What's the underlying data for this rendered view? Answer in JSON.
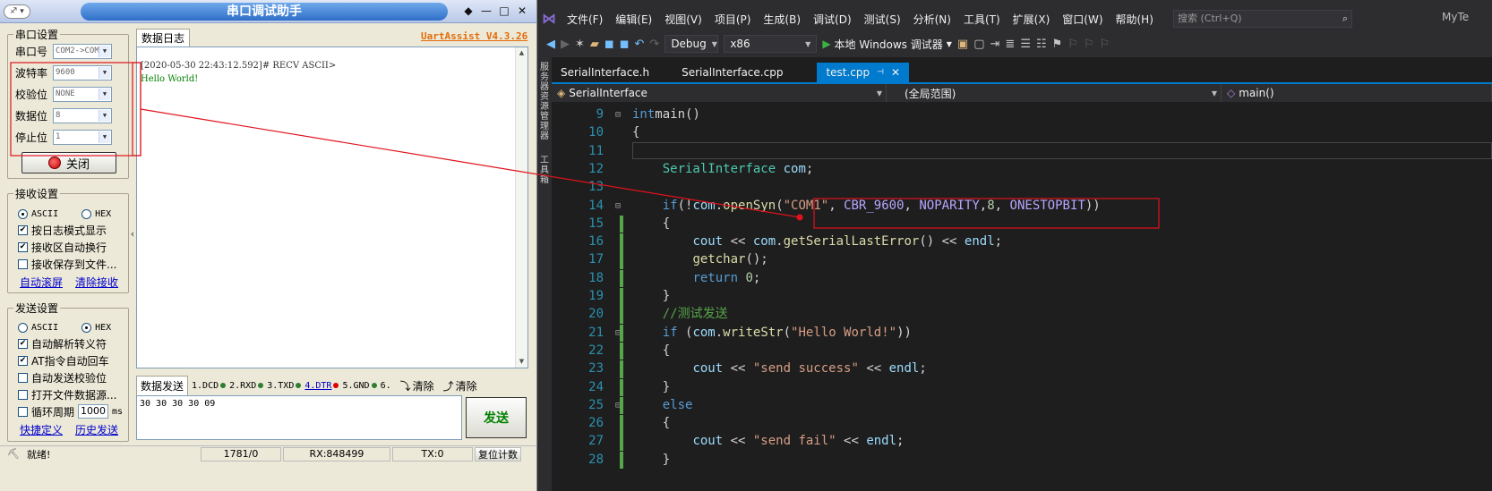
{
  "serial": {
    "title": "串口调试助手",
    "app_icon_text": "♐ ▾",
    "version": "UartAssist V4.3.26",
    "window_buttons": [
      "◆",
      "—",
      "□",
      "✕"
    ],
    "port_settings": {
      "group_title": "串口设置",
      "rows": [
        {
          "label": "串口号",
          "value": "COM2->COM"
        },
        {
          "label": "波特率",
          "value": "9600"
        },
        {
          "label": "校验位",
          "value": "NONE"
        },
        {
          "label": "数据位",
          "value": "8"
        },
        {
          "label": "停止位",
          "value": "1"
        }
      ],
      "close_button": "关闭"
    },
    "recv_settings": {
      "group_title": "接收设置",
      "ascii": "ASCII",
      "hex": "HEX",
      "checks": [
        {
          "label": "按日志模式显示",
          "checked": true
        },
        {
          "label": "接收区自动换行",
          "checked": true
        },
        {
          "label": "接收保存到文件...",
          "checked": false
        }
      ],
      "links": [
        "自动滚屏",
        "清除接收"
      ]
    },
    "send_settings": {
      "group_title": "发送设置",
      "ascii": "ASCII",
      "hex": "HEX",
      "checks": [
        {
          "label": "自动解析转义符",
          "checked": true
        },
        {
          "label": "AT指令自动回车",
          "checked": true
        },
        {
          "label": "自动发送校验位",
          "checked": false
        },
        {
          "label": "打开文件数据源...",
          "checked": false
        }
      ],
      "cycle_label": "循环周期",
      "cycle_value": "1000",
      "cycle_unit": "ms",
      "links": [
        "快捷定义",
        "历史发送"
      ]
    },
    "log_tab": "数据日志",
    "log_lines": [
      "[2020-05-30 22:43:12.592]# RECV ASCII>",
      "Hello World!"
    ],
    "send_tab": "数据发送",
    "pins": [
      {
        "label": "1.DCD",
        "color": "g"
      },
      {
        "label": "2.RXD",
        "color": "g"
      },
      {
        "label": "3.TXD",
        "color": "g"
      },
      {
        "label": "4.DTR",
        "color": "r"
      },
      {
        "label": "5.GND",
        "color": "g"
      },
      {
        "label": "6.",
        "color": "g"
      }
    ],
    "clear1": "清除",
    "clear2": "清除",
    "send_text": "30 30 30 30 09",
    "send_button": "发送",
    "status": {
      "ready": "就绪!",
      "count": "1781/0",
      "rx": "RX:848499",
      "tx": "TX:0",
      "reset": "复位计数"
    }
  },
  "vs": {
    "logo": "⋈",
    "menu": [
      "文件(F)",
      "编辑(E)",
      "视图(V)",
      "项目(P)",
      "生成(B)",
      "调试(D)",
      "测试(S)",
      "分析(N)",
      "工具(T)",
      "扩展(X)",
      "窗口(W)",
      "帮助(H)"
    ],
    "search_placeholder": "搜索 (Ctrl+Q)",
    "user": "MyTe",
    "config": "Debug",
    "platform": "x86",
    "run_label": "本地 Windows 调试器",
    "side_labels": [
      "服务器资源管理器",
      "工具箱"
    ],
    "tabs": [
      {
        "label": "SerialInterface.h",
        "active": false
      },
      {
        "label": "SerialInterface.cpp",
        "active": false
      },
      {
        "label": "test.cpp",
        "active": true
      }
    ],
    "nav": [
      "SerialInterface",
      "(全局范围)",
      "main()"
    ],
    "lines": [
      {
        "n": "9",
        "fold": "⊟",
        "bar": "",
        "code": [
          [
            "ty",
            ""
          ],
          [
            "kw",
            "int"
          ],
          [
            "",
            "main()"
          ]
        ]
      },
      {
        "n": "10",
        "fold": "",
        "bar": "",
        "code": [
          [
            "",
            "{"
          ]
        ]
      },
      {
        "n": "11",
        "fold": "",
        "bar": "",
        "code": [
          [
            "",
            ""
          ]
        ]
      },
      {
        "n": "12",
        "fold": "",
        "bar": "",
        "code": [
          [
            "",
            "    "
          ],
          [
            "ty",
            "SerialInterface"
          ],
          [
            "",
            ""
          ],
          [
            "var",
            " com"
          ],
          [
            "",
            ";"
          ]
        ]
      },
      {
        "n": "13",
        "fold": "",
        "bar": "",
        "code": [
          [
            "",
            ""
          ]
        ]
      },
      {
        "n": "14",
        "fold": "⊟",
        "bar": "",
        "code": [
          [
            "",
            "    "
          ],
          [
            "kw",
            "if"
          ],
          [
            "",
            "(!"
          ],
          [
            "var",
            "com"
          ],
          [
            "",
            "."
          ],
          [
            "fn",
            "openSyn"
          ],
          [
            "",
            "("
          ],
          [
            "st",
            "\"COM1\""
          ],
          [
            "",
            ", "
          ],
          [
            "mac",
            "CBR_9600"
          ],
          [
            "",
            ", "
          ],
          [
            "mac",
            "NOPARITY"
          ],
          [
            "",
            ","
          ],
          [
            "num",
            "8"
          ],
          [
            "",
            ", "
          ],
          [
            "mac",
            "ONESTOPBIT"
          ],
          [
            "",
            "))"
          ]
        ]
      },
      {
        "n": "15",
        "fold": "",
        "bar": "g",
        "code": [
          [
            "",
            "    {"
          ]
        ]
      },
      {
        "n": "16",
        "fold": "",
        "bar": "g",
        "code": [
          [
            "",
            "        "
          ],
          [
            "var",
            "cout"
          ],
          [
            "",
            " << "
          ],
          [
            "var",
            "com"
          ],
          [
            "",
            "."
          ],
          [
            "fn",
            "getSerialLastError"
          ],
          [
            "",
            "() << "
          ],
          [
            "var",
            "endl"
          ],
          [
            "",
            ";"
          ]
        ]
      },
      {
        "n": "17",
        "fold": "",
        "bar": "g",
        "code": [
          [
            "",
            "        "
          ],
          [
            "fn",
            "getchar"
          ],
          [
            "",
            "();"
          ]
        ]
      },
      {
        "n": "18",
        "fold": "",
        "bar": "g",
        "code": [
          [
            "",
            "        "
          ],
          [
            "kw",
            "return"
          ],
          [
            "",
            " "
          ],
          [
            "num",
            "0"
          ],
          [
            "",
            ";"
          ]
        ]
      },
      {
        "n": "19",
        "fold": "",
        "bar": "g",
        "code": [
          [
            "",
            "    }"
          ]
        ]
      },
      {
        "n": "20",
        "fold": "",
        "bar": "g",
        "code": [
          [
            "",
            "    "
          ],
          [
            "cm",
            "//测试发送"
          ]
        ]
      },
      {
        "n": "21",
        "fold": "⊟",
        "bar": "g",
        "code": [
          [
            "",
            "    "
          ],
          [
            "kw",
            "if"
          ],
          [
            "",
            " ("
          ],
          [
            "var",
            "com"
          ],
          [
            "",
            "."
          ],
          [
            "fn",
            "writeStr"
          ],
          [
            "",
            "("
          ],
          [
            "st",
            "\"Hello World!\""
          ],
          [
            "",
            "))"
          ]
        ]
      },
      {
        "n": "22",
        "fold": "",
        "bar": "g",
        "code": [
          [
            "",
            "    {"
          ]
        ]
      },
      {
        "n": "23",
        "fold": "",
        "bar": "g",
        "code": [
          [
            "",
            "        "
          ],
          [
            "var",
            "cout"
          ],
          [
            "",
            " << "
          ],
          [
            "st",
            "\"send success\""
          ],
          [
            "",
            " << "
          ],
          [
            "var",
            "endl"
          ],
          [
            "",
            ";"
          ]
        ]
      },
      {
        "n": "24",
        "fold": "",
        "bar": "g",
        "code": [
          [
            "",
            "    }"
          ]
        ]
      },
      {
        "n": "25",
        "fold": "⊟",
        "bar": "g",
        "code": [
          [
            "",
            "    "
          ],
          [
            "kw",
            "else"
          ]
        ]
      },
      {
        "n": "26",
        "fold": "",
        "bar": "g",
        "code": [
          [
            "",
            "    {"
          ]
        ]
      },
      {
        "n": "27",
        "fold": "",
        "bar": "g",
        "code": [
          [
            "",
            "        "
          ],
          [
            "var",
            "cout"
          ],
          [
            "",
            " << "
          ],
          [
            "st",
            "\"send fail\""
          ],
          [
            "",
            " << "
          ],
          [
            "var",
            "endl"
          ],
          [
            "",
            ";"
          ]
        ]
      },
      {
        "n": "28",
        "fold": "",
        "bar": "g",
        "code": [
          [
            "",
            "    }"
          ]
        ]
      }
    ]
  },
  "colors": {
    "annotation": "#e0121b",
    "vs_accent": "#007acc"
  }
}
